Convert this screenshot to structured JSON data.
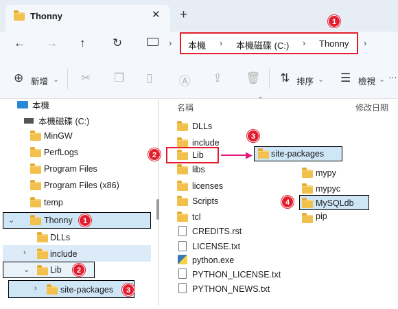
{
  "tab": {
    "title": "Thonny",
    "close": "✕",
    "add": "+"
  },
  "address": {
    "crumbs": [
      "本機",
      "本機磁碟 (C:)",
      "Thonny"
    ],
    "separator": "›"
  },
  "toolbar": {
    "new_label": "新增",
    "sort_label": "排序",
    "view_label": "檢視",
    "more": "···"
  },
  "tree": {
    "root": "本機",
    "drive": "本機磁碟 (C:)",
    "items": [
      "MinGW",
      "PerfLogs",
      "Program Files",
      "Program Files (x86)",
      "temp",
      "Thonny",
      "DLLs",
      "include",
      "Lib",
      "site-packages"
    ]
  },
  "content": {
    "col_name": "名稱",
    "col_modified": "修改日期",
    "folders": [
      "DLLs",
      "include",
      "Lib",
      "libs",
      "licenses",
      "Scripts",
      "tcl"
    ],
    "files": [
      "CREDITS.rst",
      "LICENSE.txt",
      "python.exe",
      "PYTHON_LICENSE.txt",
      "PYTHON_NEWS.txt"
    ],
    "site_packages": "site-packages",
    "sub_folders": [
      "mypy",
      "mypyc",
      "MySQLdb",
      "pip"
    ]
  },
  "badges": [
    "1",
    "2",
    "3",
    "4"
  ],
  "colors": {
    "badge": "#e11d2e",
    "arrow": "#e0197d",
    "highlight": "#cfe6f7",
    "folder": "#f2c04c"
  }
}
